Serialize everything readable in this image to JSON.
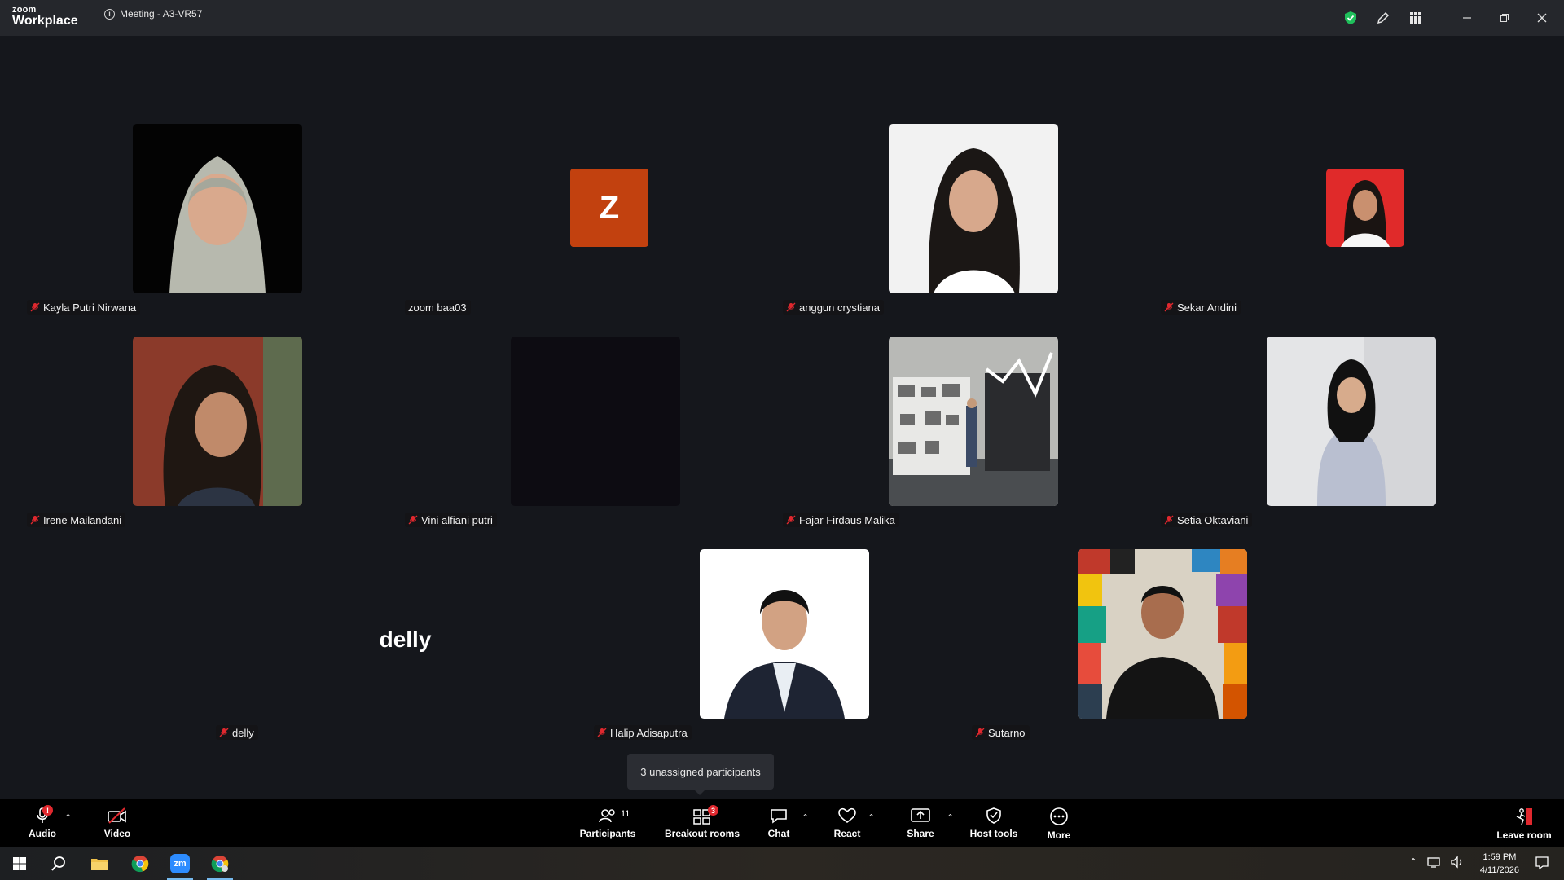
{
  "app": {
    "brand_small": "zoom",
    "brand_large": "Workplace",
    "meeting_title": "Meeting - A3-VR57"
  },
  "colors": {
    "accent_green": "#1fbf5b",
    "avatar_z": "#c2410f",
    "mute_red": "#e0282e"
  },
  "participants": [
    {
      "name": "Kayla Putri Nirwana",
      "muted": true,
      "kind": "photo"
    },
    {
      "name": "zoom baa03",
      "muted": false,
      "kind": "avatar",
      "avatar_letter": "Z"
    },
    {
      "name": "anggun crystiana",
      "muted": true,
      "kind": "photo"
    },
    {
      "name": "Sekar Andini",
      "muted": true,
      "kind": "photo-small"
    },
    {
      "name": "Irene Mailandani",
      "muted": true,
      "kind": "photo"
    },
    {
      "name": "Vini alfiani putri",
      "muted": true,
      "kind": "dark-video"
    },
    {
      "name": "Fajar Firdaus Malika",
      "muted": true,
      "kind": "photo"
    },
    {
      "name": "Setia Oktaviani",
      "muted": true,
      "kind": "photo"
    },
    {
      "name": "delly",
      "muted": true,
      "kind": "name-only",
      "display_name": "delly"
    },
    {
      "name": "Halip Adisaputra",
      "muted": true,
      "kind": "photo"
    },
    {
      "name": "Sutarno",
      "muted": true,
      "kind": "photo"
    }
  ],
  "tooltip": "3 unassigned participants",
  "toolbar": {
    "audio": "Audio",
    "video": "Video",
    "participants": "Participants",
    "participants_count": "11",
    "breakout": "Breakout rooms",
    "breakout_badge": "3",
    "chat": "Chat",
    "react": "React",
    "share": "Share",
    "host_tools": "Host tools",
    "more": "More",
    "leave": "Leave room",
    "audio_badge": "!"
  },
  "taskbar": {
    "time": "1:59 PM",
    "date": "4/11/2026"
  }
}
